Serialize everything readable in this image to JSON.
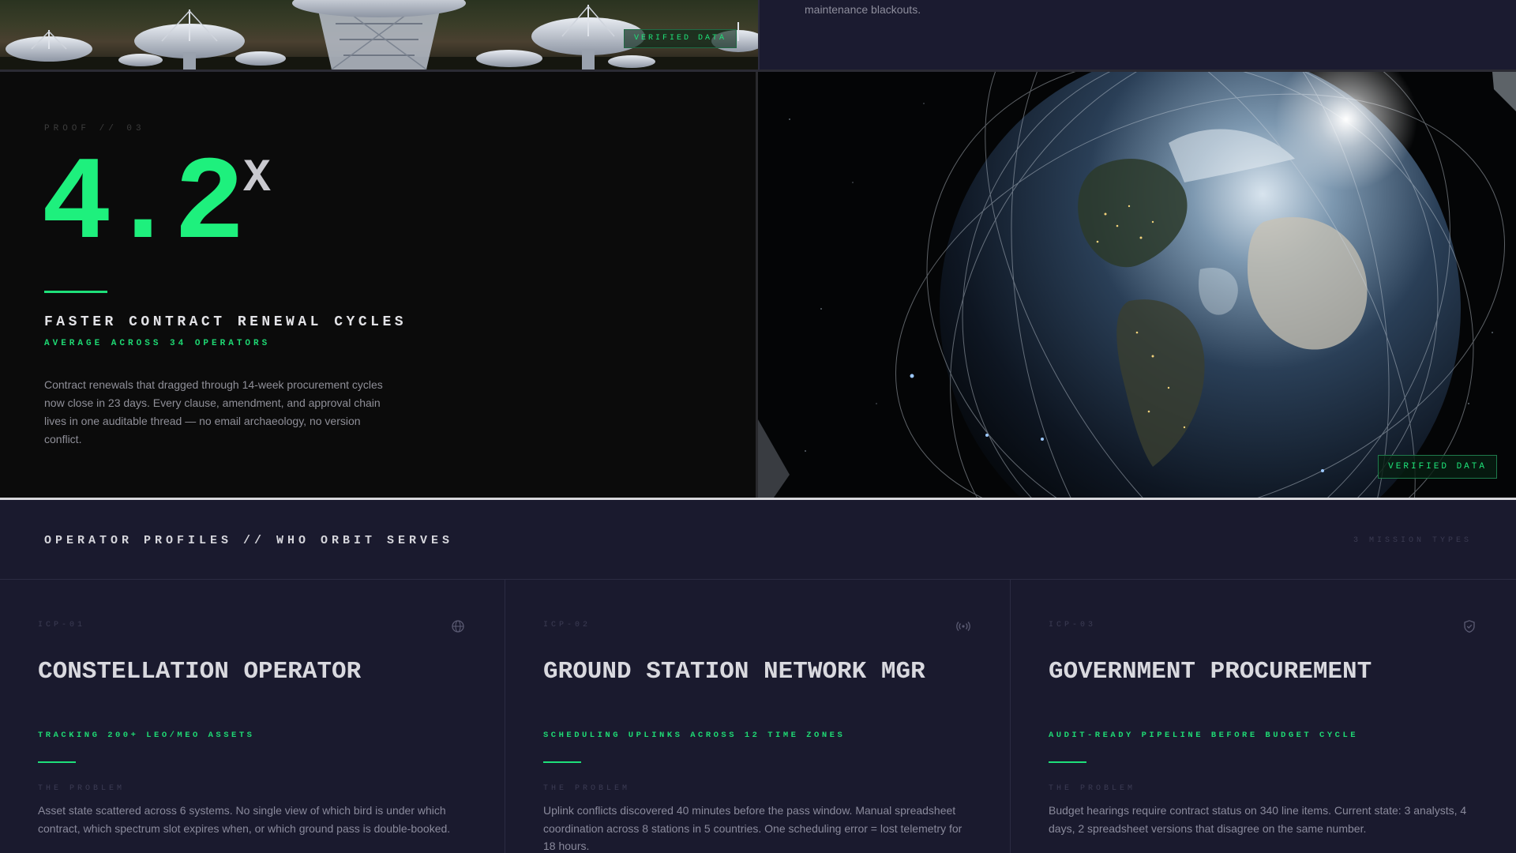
{
  "top": {
    "verified_label": "VERIFIED DATA",
    "continued_text": "maintenance blackouts."
  },
  "proof": {
    "eyebrow": "PROOF // 03",
    "stat_value": "4.2",
    "stat_unit": "X",
    "title": "FASTER CONTRACT RENEWAL CYCLES",
    "subtitle": "AVERAGE ACROSS 34 OPERATORS",
    "body": "Contract renewals that dragged through 14-week procurement cycles now close in 23 days. Every clause, amendment, and approval chain lives in one auditable thread — no email archaeology, no version conflict.",
    "accent_color": "#1ef07d"
  },
  "earth": {
    "verified_label": "VERIFIED DATA"
  },
  "profiles": {
    "title": "OPERATOR PROFILES // WHO ORBIT SERVES",
    "count": "3 MISSION TYPES",
    "cards": [
      {
        "id": "ICP-01",
        "icon": "globe-icon",
        "title": "CONSTELLATION OPERATOR",
        "tag": "TRACKING 200+ LEO/MEO ASSETS",
        "label": "THE PROBLEM",
        "body": "Asset state scattered across 6 systems. No single view of which bird is under which contract, which spectrum slot expires when, or which ground pass is double-booked."
      },
      {
        "id": "ICP-02",
        "icon": "broadcast-icon",
        "title": "GROUND STATION NETWORK MGR",
        "tag": "SCHEDULING UPLINKS ACROSS 12 TIME ZONES",
        "label": "THE PROBLEM",
        "body": "Uplink conflicts discovered 40 minutes before the pass window. Manual spreadsheet coordination across 8 stations in 5 countries. One scheduling error = lost telemetry for 18 hours."
      },
      {
        "id": "ICP-03",
        "icon": "shield-icon",
        "title": "GOVERNMENT PROCUREMENT",
        "tag": "AUDIT-READY PIPELINE BEFORE BUDGET CYCLE",
        "label": "THE PROBLEM",
        "body": "Budget hearings require contract status on 340 line items. Current state: 3 analysts, 4 days, 2 spreadsheet versions that disagree on the same number."
      }
    ]
  }
}
